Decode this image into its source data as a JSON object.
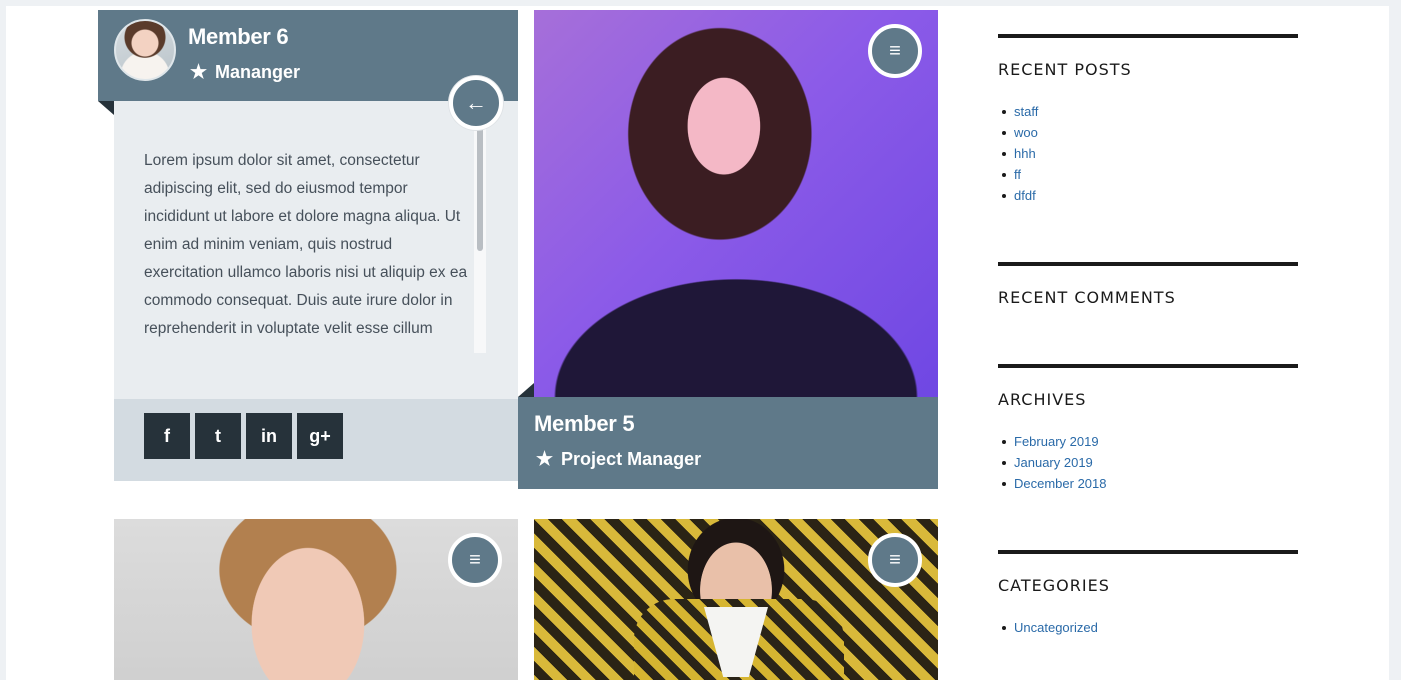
{
  "members": {
    "m6": {
      "name": "Member 6",
      "role": "Mananger",
      "description": "Lorem ipsum dolor sit amet, consectetur adipiscing elit, sed do eiusmod tempor incididunt ut labore et dolore magna aliqua. Ut enim ad minim veniam, quis nostrud exercitation ullamco laboris nisi ut aliquip ex ea commodo consequat. Duis aute irure dolor in reprehenderit in voluptate velit esse cillum",
      "social": {
        "facebook": "f",
        "twitter": "t",
        "linkedin": "in",
        "google_plus": "g+"
      }
    },
    "m5": {
      "name": "Member 5",
      "role": "Project Manager"
    }
  },
  "icons": {
    "back": "←",
    "menu": "≡",
    "star": "★"
  },
  "sidebar": {
    "recent_posts": {
      "title": "RECENT POSTS",
      "items": [
        "staff",
        "woo",
        "hhh",
        "ff",
        "dfdf"
      ]
    },
    "recent_comments": {
      "title": "RECENT COMMENTS"
    },
    "archives": {
      "title": "ARCHIVES",
      "items": [
        "February 2019",
        "January 2019",
        "December 2018"
      ]
    },
    "categories": {
      "title": "CATEGORIES",
      "items": [
        "Uncategorized"
      ]
    }
  },
  "colors": {
    "accent": "#5f7989",
    "dark": "#26323a",
    "link": "#2a6aa8"
  }
}
